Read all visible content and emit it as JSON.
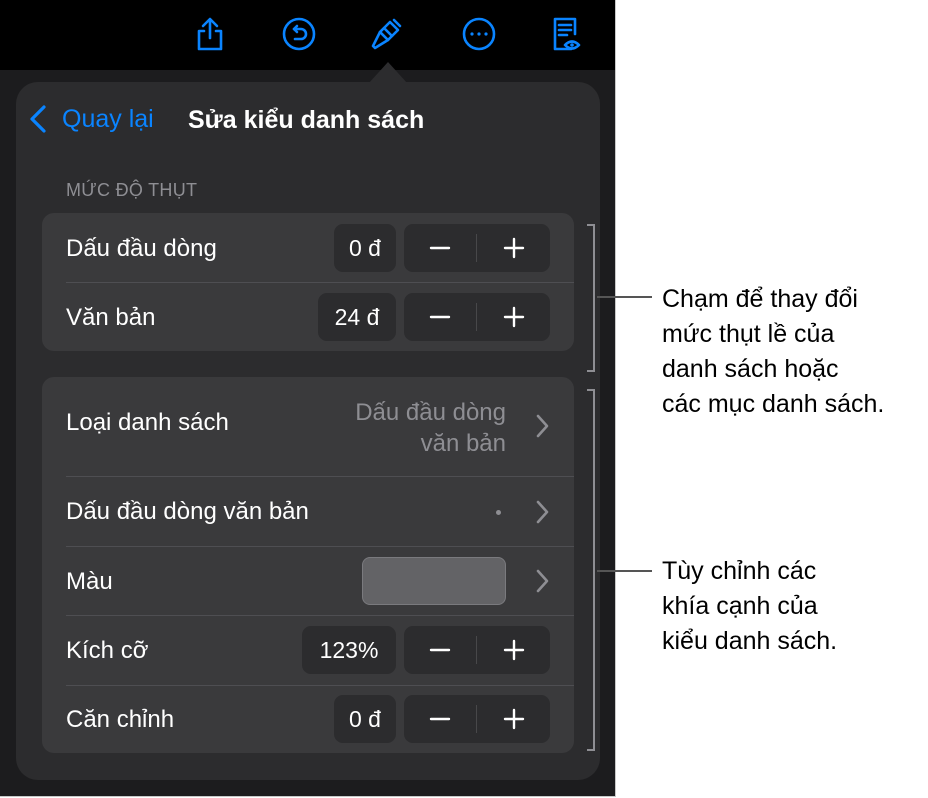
{
  "toolbar": {
    "icons": [
      "share-icon",
      "undo-icon",
      "paintbrush-icon",
      "more-icon",
      "reading-view-icon"
    ],
    "accent_color": "#0a84ff"
  },
  "nav": {
    "back_label": "Quay lại",
    "title": "Sửa kiểu danh sách"
  },
  "indent_section": {
    "header": "MỨC ĐỘ THỤT",
    "rows": [
      {
        "label": "Dấu đầu dòng",
        "value": "0 đ"
      },
      {
        "label": "Văn bản",
        "value": "24 đ"
      }
    ]
  },
  "style_section": {
    "list_type": {
      "label": "Loại danh sách",
      "value_line1": "Dấu đầu dòng",
      "value_line2": "văn bản"
    },
    "text_bullet": {
      "label": "Dấu đầu dòng văn bản",
      "value": "•"
    },
    "color": {
      "label": "Màu",
      "swatch_color": "#636366"
    },
    "size": {
      "label": "Kích cỡ",
      "value": "123%"
    },
    "align": {
      "label": "Căn chỉnh",
      "value": "0 đ"
    }
  },
  "callouts": {
    "indent": "Chạm để thay đổi\nmức thụt lề của\ndanh sách hoặc\ncác mục danh sách.",
    "style": "Tùy chỉnh các\nkhía cạnh của\nkiểu danh sách."
  }
}
